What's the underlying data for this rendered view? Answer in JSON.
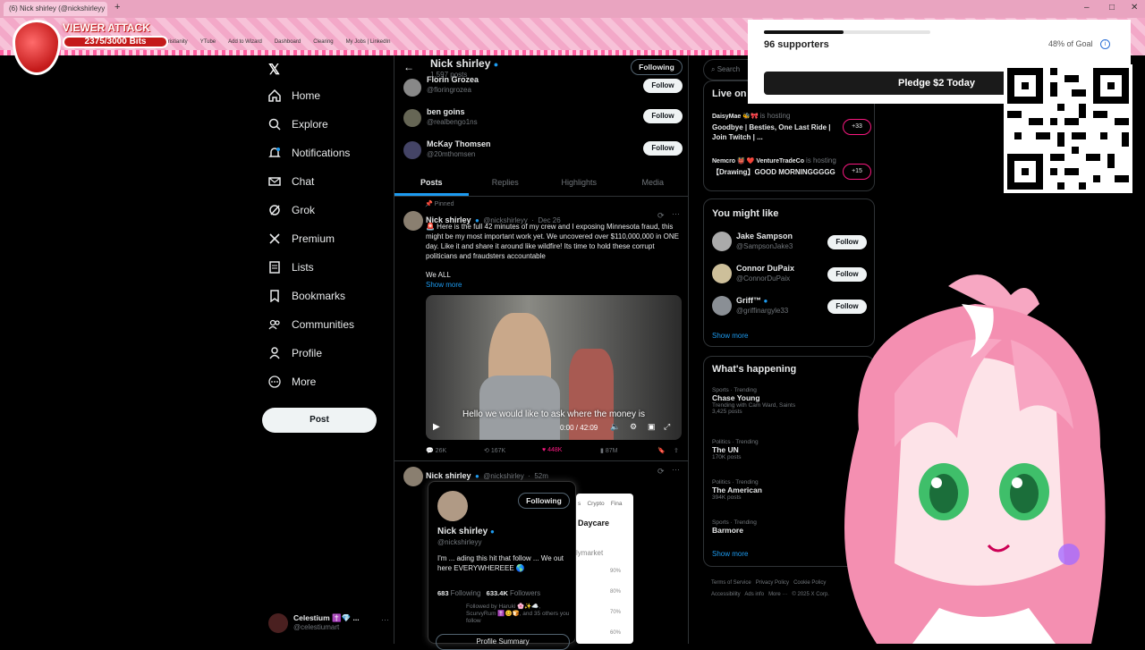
{
  "browser": {
    "tab_title": "(6) Nick shirley (@nickshirleyy",
    "bookmarks": [
      "Christianity",
      "YTube",
      "Add to Wizard",
      "Dashboard",
      "Clearing",
      "My Jobs | LinkedIn"
    ]
  },
  "viewer_attack": {
    "title": "VIEWER ATTACK",
    "progress": "2375/3000 Bits"
  },
  "sidebar": {
    "items": [
      {
        "label": "Home",
        "icon": "home-icon"
      },
      {
        "label": "Explore",
        "icon": "search-icon"
      },
      {
        "label": "Notifications",
        "icon": "bell-icon"
      },
      {
        "label": "Chat",
        "icon": "mail-icon"
      },
      {
        "label": "Grok",
        "icon": "grok-icon"
      },
      {
        "label": "Premium",
        "icon": "x-icon"
      },
      {
        "label": "Lists",
        "icon": "list-icon"
      },
      {
        "label": "Bookmarks",
        "icon": "bookmark-icon"
      },
      {
        "label": "Communities",
        "icon": "people-icon"
      },
      {
        "label": "Profile",
        "icon": "person-icon"
      },
      {
        "label": "More",
        "icon": "more-icon"
      }
    ],
    "post_label": "Post",
    "account": {
      "name": "Celestium ✝️💎 ...",
      "handle": "@celestiumart"
    }
  },
  "profile_header": {
    "name": "Nick shirley",
    "posts": "1,597 posts",
    "following_label": "Following"
  },
  "follow_list": [
    {
      "name": "Florin Grozea",
      "handle": "@floringrozea",
      "button": "Follow"
    },
    {
      "name": "ben goins",
      "handle": "@realbengo1ns",
      "button": "Follow"
    },
    {
      "name": "McKay Thomsen",
      "handle": "@20mthomsen",
      "button": "Follow"
    }
  ],
  "tabs": [
    "Posts",
    "Replies",
    "Highlights",
    "Media"
  ],
  "pinned_tweet": {
    "pinned_label": "Pinned",
    "name": "Nick shirley",
    "handle": "@nickshirleyy",
    "date": "Dec 26",
    "text": "🚨 Here is the full 42 minutes of my crew and I exposing Minnesota fraud, this might be my most important work yet. We uncovered over $110,000,000 in ONE day. Like it and share it around like wildfire! Its time to hold these corrupt politicians and fraudsters accountable",
    "text2": "We ALL",
    "show_more": "Show more",
    "video_caption": "Hello we would like to ask where the money is",
    "video_time": "0:00 / 42:09",
    "stats": {
      "replies": "26K",
      "reposts": "167K",
      "likes": "448K",
      "views": "87M"
    }
  },
  "second_tweet": {
    "name": "Nick shirley",
    "handle": "@nickshirley",
    "time": "52m"
  },
  "hover_card": {
    "following_label": "Following",
    "name": "Nick shirley",
    "handle": "@nickshirleyy",
    "bio": "I'm ... ading this hit that follow ... We out here EVERYWHEREEE 🌎",
    "following_count": "683",
    "following_label2": "Following",
    "followers_count": "633.4K",
    "followers_label": "Followers",
    "followed_by": "Followed by Haruki 🌸✨☁️, ScurvyRum ✝️😊🍞, and 35 others you follow",
    "profile_summary": "Profile Summary"
  },
  "market_popup": {
    "tabs": [
      "s",
      "Crypto",
      "Fina"
    ],
    "title": "Daycare",
    "brand": "lymarket",
    "ticks": [
      "90%",
      "80%",
      "70%",
      "60%"
    ]
  },
  "search_placeholder": "Search",
  "live": {
    "title": "Live on",
    "items": [
      {
        "host": "DaisyMae 🐝🎀",
        "status": "is hosting",
        "title": "Goodbye | Besties, One Last Ride | Join Twitch | ...",
        "count": "+33"
      },
      {
        "host": "Nemcro 👹 ❤️ VentureTradeCo",
        "status": "is hosting",
        "title": "【Drawing】GOOD MORNINGGGGG",
        "count": "+15"
      }
    ]
  },
  "you_might_like": {
    "title": "You might like",
    "items": [
      {
        "name": "Jake Sampson",
        "handle": "@SampsonJake3",
        "button": "Follow"
      },
      {
        "name": "Connor DuPaix",
        "handle": "@ConnorDuPaix",
        "button": "Follow"
      },
      {
        "name": "Griff™",
        "handle": "@griffinargyle33",
        "button": "Follow"
      }
    ],
    "show_more": "Show more"
  },
  "whats_happening": {
    "title": "What's happening",
    "trends": [
      {
        "meta": "Sports · Trending",
        "name": "Chase Young",
        "extra": "Trending with Cam Ward, Saints",
        "posts": "3,425 posts"
      },
      {
        "meta": "Politics · Trending",
        "name": "The UN",
        "posts": "170K posts"
      },
      {
        "meta": "Politics · Trending",
        "name": "The American",
        "posts": "394K posts"
      },
      {
        "meta": "Sports · Trending",
        "name": "Barmore",
        "posts": ""
      }
    ],
    "show_more": "Show more"
  },
  "footer_links": [
    "Terms of Service",
    "Privacy Policy",
    "Cookie Policy",
    "Accessibility",
    "Ads info",
    "More ···",
    "© 2025 X Corp."
  ],
  "goal_overlay": {
    "supporters": "96 supporters",
    "goal_text": "48% of Goal",
    "progress": 0.48,
    "pledge_label": "Pledge $2 Today"
  },
  "colors": {
    "accent": "#1d9bf0",
    "like": "#f91880",
    "bg": "#000000",
    "overlay_pink": "#f3a8c8"
  }
}
